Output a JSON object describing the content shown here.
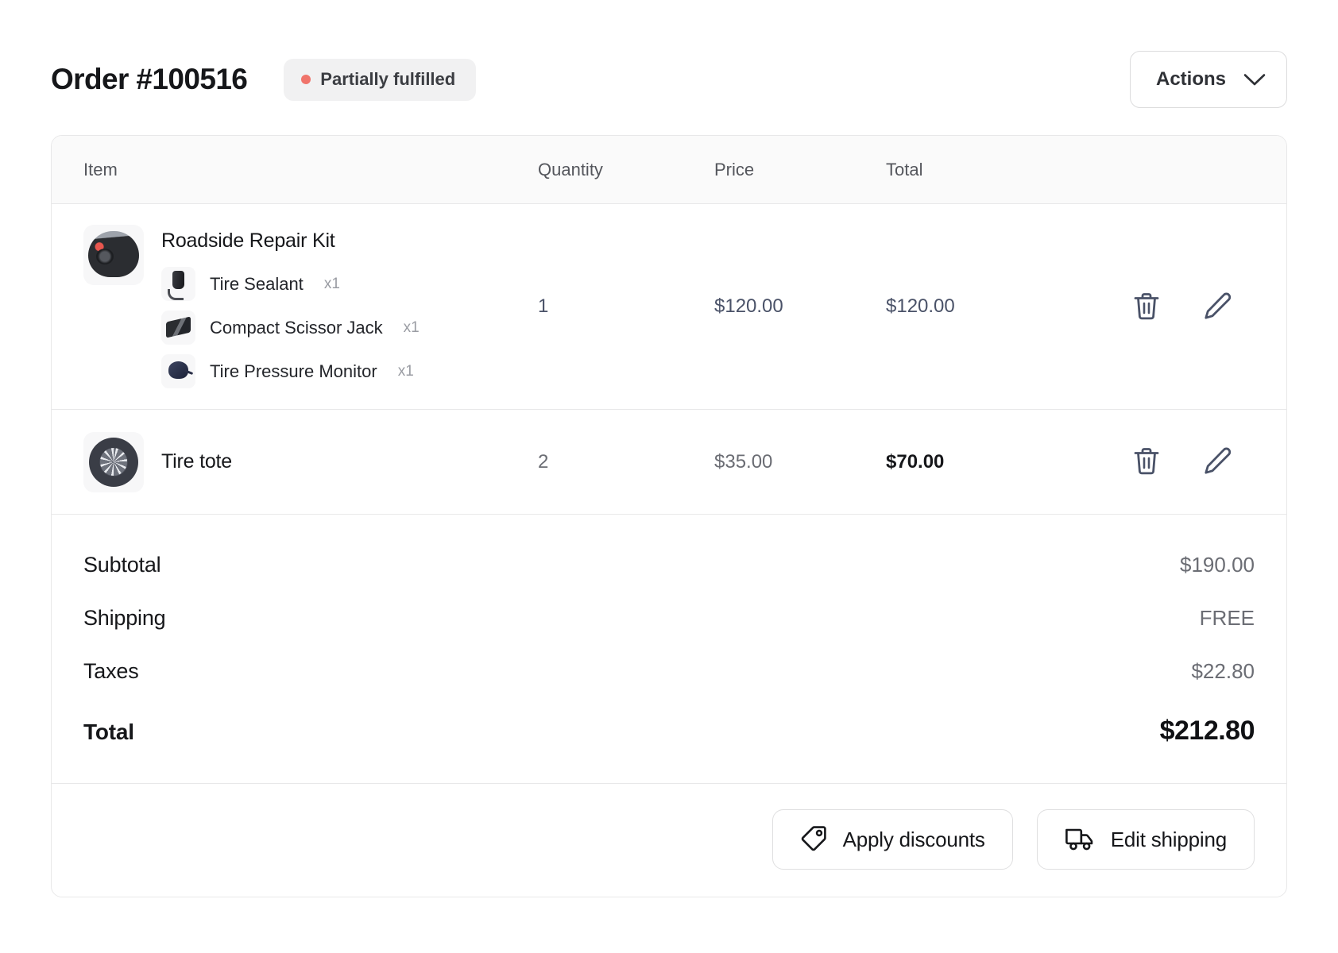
{
  "header": {
    "title": "Order #100516",
    "status": {
      "label": "Partially fulfilled",
      "dot_color": "#f0746b",
      "bg_color": "#f1f1f2"
    },
    "actions_button": {
      "label": "Actions",
      "icon": "chevron-down-icon"
    }
  },
  "table": {
    "columns": [
      "Item",
      "Quantity",
      "Price",
      "Total"
    ],
    "rows": [
      {
        "name": "Roadside Repair Kit",
        "thumb_icon": "roadside-repair-kit-image",
        "variants": [
          {
            "name": "Tire Sealant",
            "qty": "x1",
            "thumb_icon": "tire-sealant-image"
          },
          {
            "name": "Compact Scissor Jack",
            "qty": "x1",
            "thumb_icon": "compact-scissor-jack-image"
          },
          {
            "name": "Tire Pressure Monitor",
            "qty": "x1",
            "thumb_icon": "tire-pressure-monitor-image"
          }
        ],
        "quantity": "1",
        "price": "$120.00",
        "total": "$120.00",
        "value_style": "slate",
        "delete_icon": "trash-icon",
        "edit_icon": "pencil-icon"
      },
      {
        "name": "Tire tote",
        "thumb_icon": "tire-tote-image",
        "variants": [],
        "quantity": "2",
        "price": "$35.00",
        "total": "$70.00",
        "value_style": "dark",
        "delete_icon": "trash-icon",
        "edit_icon": "pencil-icon"
      }
    ]
  },
  "summary": {
    "subtotal_label": "Subtotal",
    "subtotal_value": "$190.00",
    "shipping_label": "Shipping",
    "shipping_value": "FREE",
    "taxes_label": "Taxes",
    "taxes_value": "$22.80",
    "total_label": "Total",
    "total_value": "$212.80"
  },
  "footer": {
    "apply_discounts": {
      "label": "Apply discounts",
      "icon": "tag-icon"
    },
    "edit_shipping": {
      "label": "Edit shipping",
      "icon": "truck-icon"
    }
  }
}
